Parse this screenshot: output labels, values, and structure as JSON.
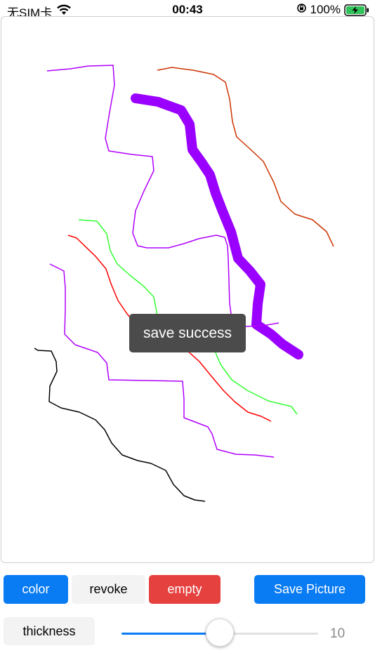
{
  "status_bar": {
    "carrier": "无SIM卡",
    "time": "00:43",
    "battery_percent": "100%",
    "icons": [
      "wifi-icon",
      "orientation-lock-icon",
      "battery-charging-icon"
    ]
  },
  "drawing": {
    "strokes": [
      {
        "color": "#9a00ff",
        "width": "thick"
      },
      {
        "color": "#b000ff",
        "width": "thin"
      },
      {
        "color": "#cc3300",
        "width": "thin"
      },
      {
        "color": "#ff0000",
        "width": "thin"
      },
      {
        "color": "#33ff33",
        "width": "thin"
      },
      {
        "color": "#000000",
        "width": "thin"
      }
    ]
  },
  "toast": {
    "text": "save success"
  },
  "toolbar": {
    "color_label": "color",
    "revoke_label": "revoke",
    "empty_label": "empty",
    "save_label": "Save Picture",
    "thickness_label": "thickness"
  },
  "slider": {
    "value": "10",
    "fraction": 0.5
  },
  "colors": {
    "accent": "#0a7cf3",
    "danger": "#e5413f"
  }
}
